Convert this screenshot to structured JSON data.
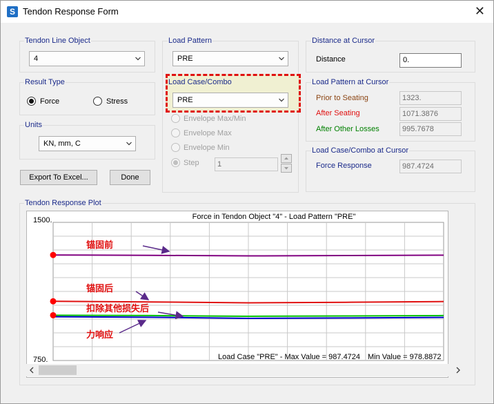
{
  "window": {
    "title": "Tendon Response Form",
    "app_icon_letter": "S",
    "close_glyph": "✕"
  },
  "tendon_line_object": {
    "label": "Tendon Line Object",
    "value": "4"
  },
  "load_pattern": {
    "label": "Load Pattern",
    "value": "PRE"
  },
  "distance_at_cursor": {
    "label": "Distance at Cursor",
    "distance_label": "Distance",
    "distance_value": "0."
  },
  "result_type": {
    "label": "Result Type",
    "force_label": "Force",
    "stress_label": "Stress",
    "selected": "Force"
  },
  "load_case_combo": {
    "label": "Load Case/Combo",
    "value": "PRE",
    "options": [
      {
        "label": "Envelope Max/Min",
        "checked": false
      },
      {
        "label": "Envelope Max",
        "checked": false
      },
      {
        "label": "Envelope Min",
        "checked": false
      },
      {
        "label": "Step",
        "checked": true
      }
    ],
    "step_value": "1"
  },
  "load_pattern_at_cursor": {
    "label": "Load Pattern at Cursor",
    "rows": [
      {
        "label": "Prior to Seating",
        "value": "1323.",
        "color": "#8b4513"
      },
      {
        "label": "After Seating",
        "value": "1071.3876",
        "color": "#e01010"
      },
      {
        "label": "After Other Losses",
        "value": "995.7678",
        "color": "#008000"
      }
    ]
  },
  "load_case_at_cursor": {
    "label": "Load Case/Combo at Cursor",
    "force_response_label": "Force Response",
    "force_response_value": "987.4724"
  },
  "units": {
    "label": "Units",
    "value": "KN, mm, C"
  },
  "buttons": {
    "export_label": "Export To Excel...",
    "done_label": "Done"
  },
  "plot": {
    "group_label": "Tendon Response Plot",
    "colors": {
      "purple": "#800080",
      "red": "#e01010",
      "green": "#00c000",
      "blue": "#0000cc",
      "annotation": "#e01010"
    },
    "annotations": [
      "锚固前",
      "锚固后",
      "扣除其他损失后",
      "力响应"
    ]
  },
  "chart_data": {
    "type": "line",
    "title": "Force in Tendon Object \"4\" - Load Pattern \"PRE\"",
    "ylim": [
      750,
      1500
    ],
    "ytick_labels": [
      "1500.",
      "750."
    ],
    "footer_left": "Load Case \"PRE\" - Max Value = 987.4724",
    "footer_right": "Min Value = 978.8872",
    "grid": true,
    "x": [
      0,
      0.25,
      0.5,
      0.75,
      1.0
    ],
    "series": [
      {
        "values": [
          1323,
          1321,
          1318,
          1320,
          1322
        ]
      },
      {
        "values": [
          1071.39,
          1068,
          1063,
          1066,
          1070
        ]
      },
      {
        "values": [
          995.77,
          994,
          990,
          992,
          994
        ]
      },
      {
        "values": [
          987.47,
          985,
          978.89,
          981,
          984
        ]
      }
    ]
  }
}
